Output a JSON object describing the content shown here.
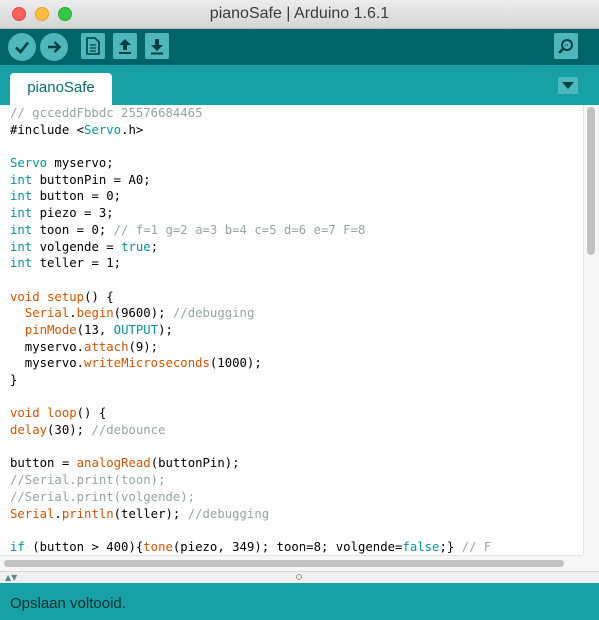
{
  "window": {
    "title": "pianoSafe | Arduino 1.6.1"
  },
  "toolbar": {
    "buttons": [
      "verify-icon",
      "upload-icon",
      "new-icon",
      "open-icon",
      "save-icon",
      "serial-monitor-icon"
    ]
  },
  "tabs": {
    "active": "pianoSafe"
  },
  "editor": {
    "lines": [
      [
        [
          "cm",
          "// gcceddFbbdc 25576684465"
        ]
      ],
      [
        [
          "",
          "#include <"
        ],
        [
          "kw",
          "Servo"
        ],
        [
          "",
          ".h>"
        ]
      ],
      [],
      [
        [
          "kw",
          "Servo"
        ],
        [
          "",
          " myservo;"
        ]
      ],
      [
        [
          "kw",
          "int"
        ],
        [
          "",
          " buttonPin = A0;"
        ]
      ],
      [
        [
          "kw",
          "int"
        ],
        [
          "",
          " button = 0;"
        ]
      ],
      [
        [
          "kw",
          "int"
        ],
        [
          "",
          " piezo = 3;"
        ]
      ],
      [
        [
          "kw",
          "int"
        ],
        [
          "",
          " toon = 0; "
        ],
        [
          "cm",
          "// f=1 g=2 a=3 b=4 c=5 d=6 e=7 F=8"
        ]
      ],
      [
        [
          "kw",
          "int"
        ],
        [
          "",
          " volgende = "
        ],
        [
          "kw",
          "true"
        ],
        [
          "",
          ";"
        ]
      ],
      [
        [
          "kw",
          "int"
        ],
        [
          "",
          " teller = 1;"
        ]
      ],
      [],
      [
        [
          "fn",
          "void"
        ],
        [
          "",
          " "
        ],
        [
          "fn",
          "setup"
        ],
        [
          "",
          "() {"
        ]
      ],
      [
        [
          "",
          "  "
        ],
        [
          "fn",
          "Serial"
        ],
        [
          "",
          "."
        ],
        [
          "fn",
          "begin"
        ],
        [
          "",
          "(9600); "
        ],
        [
          "cm",
          "//debugging"
        ]
      ],
      [
        [
          "",
          "  "
        ],
        [
          "fn",
          "pinMode"
        ],
        [
          "",
          "(13, "
        ],
        [
          "lt",
          "OUTPUT"
        ],
        [
          "",
          ");"
        ]
      ],
      [
        [
          "",
          "  myservo."
        ],
        [
          "fn",
          "attach"
        ],
        [
          "",
          "(9);"
        ]
      ],
      [
        [
          "",
          "  myservo."
        ],
        [
          "fn",
          "writeMicroseconds"
        ],
        [
          "",
          "(1000);"
        ]
      ],
      [
        [
          "",
          "}"
        ]
      ],
      [],
      [
        [
          "fn",
          "void"
        ],
        [
          "",
          " "
        ],
        [
          "fn",
          "loop"
        ],
        [
          "",
          "() {"
        ]
      ],
      [
        [
          "fn",
          "delay"
        ],
        [
          "",
          "(30); "
        ],
        [
          "cm",
          "//debounce"
        ]
      ],
      [],
      [
        [
          "",
          "button = "
        ],
        [
          "fn",
          "analogRead"
        ],
        [
          "",
          "(buttonPin);"
        ]
      ],
      [
        [
          "cm",
          "//Serial.print(toon);"
        ]
      ],
      [
        [
          "cm",
          "//Serial.print(volgende);"
        ]
      ],
      [
        [
          "fn",
          "Serial"
        ],
        [
          "",
          "."
        ],
        [
          "fn",
          "println"
        ],
        [
          "",
          "(teller); "
        ],
        [
          "cm",
          "//debugging"
        ]
      ],
      [],
      [
        [
          "kw",
          "if"
        ],
        [
          "",
          " (button > 400){"
        ],
        [
          "fn",
          "tone"
        ],
        [
          "",
          "(piezo, 349); toon=8; volgende="
        ],
        [
          "kw",
          "false"
        ],
        [
          "",
          ";} "
        ],
        [
          "cm",
          "// F"
        ]
      ]
    ]
  },
  "status": {
    "message": "Opslaan voltooid."
  },
  "colors": {
    "toolbar": "#006468",
    "tabstrip": "#17a1a5",
    "button": "#4db7bb",
    "keyword": "#00979c",
    "function": "#d35400",
    "comment": "#95a5a6"
  }
}
